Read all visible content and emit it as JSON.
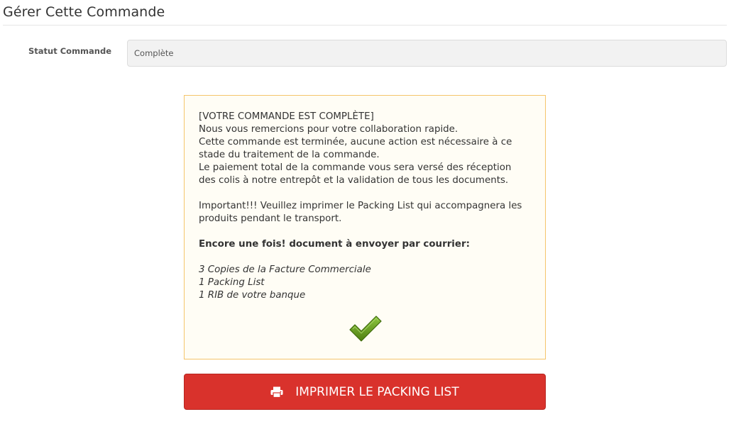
{
  "page": {
    "title": "Gérer Cette Commande"
  },
  "form": {
    "status_label": "Statut Commande",
    "status_value": "Complète"
  },
  "notice": {
    "header": "[VOTRE COMMANDE EST COMPLÈTE]",
    "line1": "Nous vous remercions pour votre collaboration rapide.",
    "line2": "Cette commande est terminée, aucune action est nécessaire à ce stade du traitement de la commande.",
    "line3": "Le paiement total de la commande vous sera versé des réception des colis à notre entrepôt et la validation de tous les documents.",
    "important": "Important!!! Veuillez imprimer le Packing List qui accompagnera les produits pendant le transport.",
    "emphasis": "Encore une fois! document à envoyer par courrier:",
    "documents": [
      "3 Copies de la Facture Commerciale",
      "1 Packing List",
      "1 RIB de votre banque"
    ],
    "icon": "checkmark-icon",
    "accent_color": "#f5c56b",
    "check_color": "#6a9a1f"
  },
  "actions": {
    "print_label": "IMPRIMER LE PACKING LIST",
    "print_icon": "printer-icon",
    "button_color": "#d9322c"
  }
}
